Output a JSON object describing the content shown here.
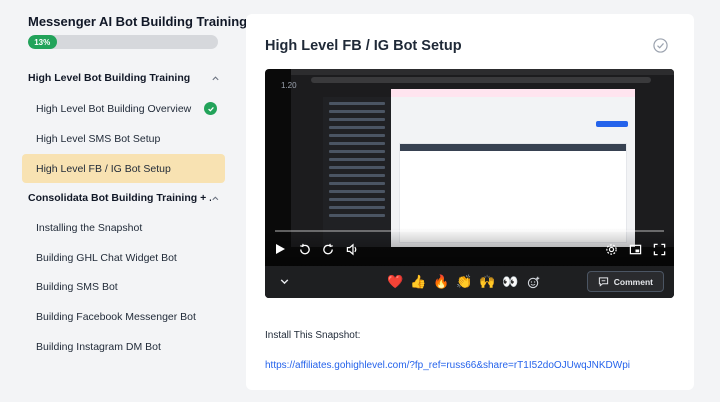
{
  "course": {
    "title": "Messenger AI Bot Building Training",
    "progress_label": "13%",
    "progress_fraction": 0.13
  },
  "sections": [
    {
      "title": "High Level Bot Building Training",
      "expanded": true,
      "lessons": [
        {
          "label": "High Level Bot Building Overview",
          "completed": true,
          "active": false
        },
        {
          "label": "High Level SMS Bot Setup",
          "completed": false,
          "active": false
        },
        {
          "label": "High Level FB / IG Bot Setup",
          "completed": false,
          "active": true
        }
      ]
    },
    {
      "title": "Consolidata Bot Building Training + ...",
      "expanded": true,
      "lessons": [
        {
          "label": "Installing the Snapshot",
          "completed": false,
          "active": false
        },
        {
          "label": "Building GHL Chat Widget Bot",
          "completed": false,
          "active": false
        },
        {
          "label": "Building SMS Bot",
          "completed": false,
          "active": false
        },
        {
          "label": "Building Facebook Messenger Bot",
          "completed": false,
          "active": false
        },
        {
          "label": "Building Instagram DM Bot",
          "completed": false,
          "active": false
        }
      ]
    }
  ],
  "main": {
    "lesson_title": "High Level FB / IG Bot Setup",
    "video": {
      "timestamp": "1.20"
    },
    "reactions": [
      "❤️",
      "👍",
      "🔥",
      "👏",
      "🙌",
      "👀"
    ],
    "comment_label": "Comment",
    "snapshot_label": "Install This Snapshot:",
    "snapshot_link": "https://affiliates.gohighlevel.com/?fp_ref=russ66&share=rT1I52doOJUwqJNKDWpi"
  },
  "colors": {
    "accent_green": "#22a35a",
    "active_bg": "#f8e2b2",
    "link": "#2563eb"
  },
  "icons": {
    "section_toggle": "chevron-up-icon",
    "lesson_done": "check-circle-icon",
    "mark_complete": "check-circle-outline-icon"
  }
}
